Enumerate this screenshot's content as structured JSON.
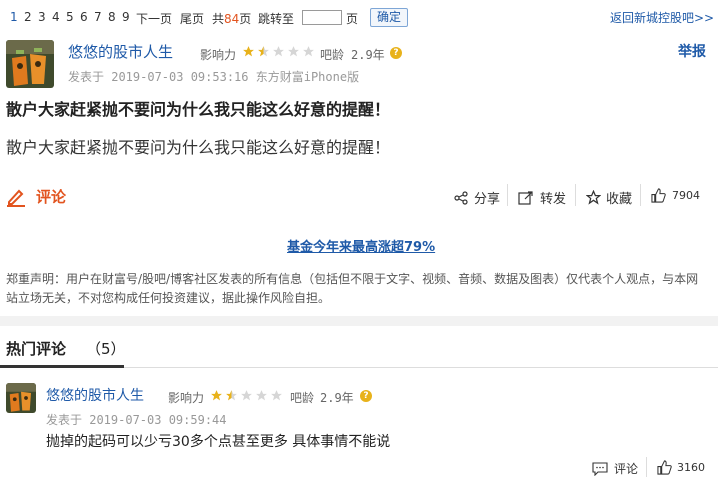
{
  "pager": {
    "pages": [
      "1",
      "2",
      "3",
      "4",
      "5",
      "6",
      "7",
      "8",
      "9"
    ],
    "next": "下一页",
    "last": "尾页",
    "total_prefix": "共",
    "total_pages": "84",
    "total_suffix": "页",
    "goto_label": "跳转至",
    "goto_suffix": "页",
    "goto_value": "",
    "confirm": "确定",
    "back_link": "返回新城控股吧>>"
  },
  "post": {
    "username": "悠悠的股市人生",
    "influence_label": "影响力",
    "influence_rating": 1.5,
    "bar_age_label": "吧龄",
    "bar_age": "2.9年",
    "report": "举报",
    "posted_at": "发表于 2019-07-03 09:53:16 东方财富iPhone版",
    "title": "散户大家赶紧抛不要问为什么我只能这么好意的提醒！",
    "body": "散户大家赶紧抛不要问为什么我只能这么好意的提醒！",
    "comment_label": "评论",
    "share_label": "分享",
    "repost_label": "转发",
    "favorite_label": "收藏",
    "like_count": "7904",
    "ad_link": "基金今年来最高涨超79%",
    "disclaimer": "郑重声明：用户在财富号/股吧/博客社区发表的所有信息（包括但不限于文字、视频、音频、数据及图表）仅代表个人观点，与本网站立场无关，不对您构成任何投资建议，据此操作风险自担。"
  },
  "hot": {
    "title": "热门评论",
    "count": "（5）"
  },
  "reply": {
    "username": "悠悠的股市人生",
    "influence_label": "影响力",
    "influence_rating": 1.5,
    "bar_age_label": "吧龄",
    "bar_age": "2.9年",
    "posted_at": "发表于 2019-07-03 09:59:44",
    "text": "抛掉的起码可以少亏30多个点甚至更多 具体事情不能说",
    "comment_label": "评论",
    "like_count": "3160"
  },
  "colors": {
    "link_blue": "#1f5aa8",
    "accent_orange": "#e2541f",
    "star_gold": "#e8b21b"
  }
}
